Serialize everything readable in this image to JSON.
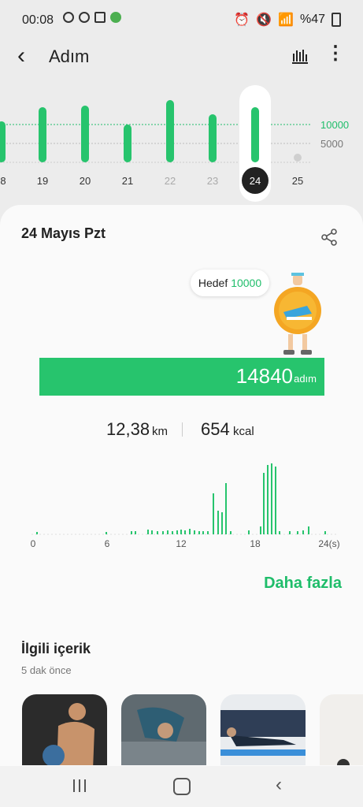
{
  "status": {
    "time": "00:08",
    "battery": "%47"
  },
  "header": {
    "title": "Adım"
  },
  "week": {
    "days": [
      "8",
      "19",
      "20",
      "21",
      "22",
      "23",
      "24",
      "25"
    ],
    "selected_day": "24",
    "goal_line_label": "10000",
    "half_line_label": "5000"
  },
  "day": {
    "date": "24 Mayıs Pzt",
    "goal_label": "Hedef",
    "goal_value": "10000",
    "steps": "14840",
    "steps_unit": "adım",
    "distance": "12,38",
    "distance_unit": "km",
    "calories": "654",
    "calories_unit": "kcal"
  },
  "hourly_axis": [
    "0",
    "6",
    "12",
    "18",
    "24(s)"
  ],
  "more_label": "Daha fazla",
  "related": {
    "title": "İlgili içerik",
    "time": "5 dak önce"
  },
  "colors": {
    "accent": "#27c46d",
    "goal_line": "#1fbd6a"
  },
  "icons": [
    "back-icon",
    "bar-chart-icon",
    "more-icon",
    "share-icon",
    "recent-apps-icon",
    "home-icon",
    "nav-back-icon"
  ]
}
